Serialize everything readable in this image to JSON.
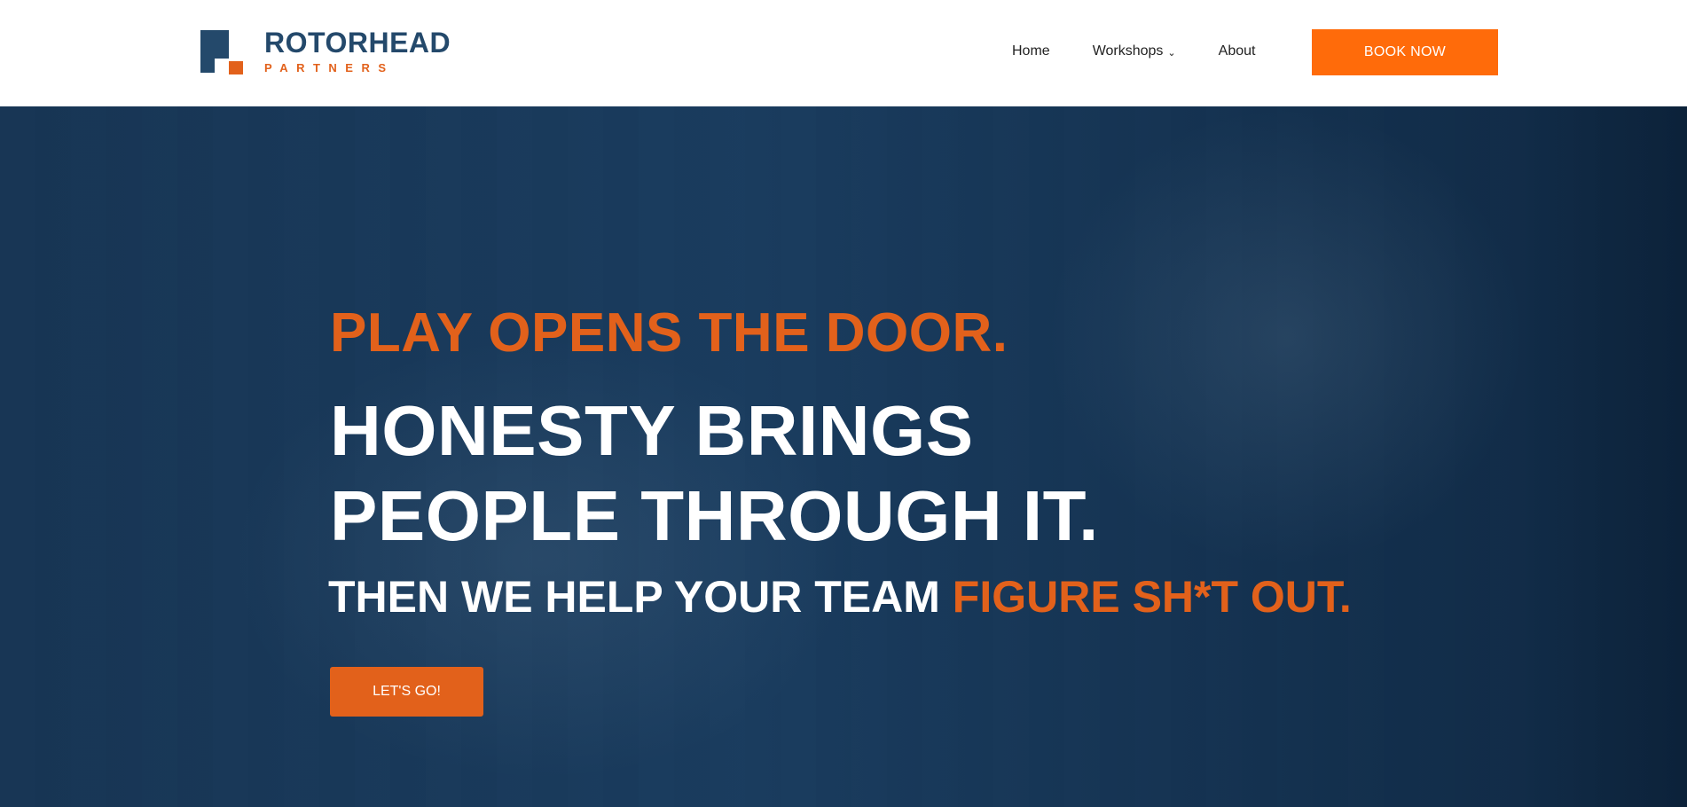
{
  "header": {
    "logo": {
      "title": "ROTORHEAD",
      "subtitle": "PARTNERS",
      "mark_icon": "rotorhead-logo-icon"
    },
    "nav": {
      "home": "Home",
      "workshops": "Workshops",
      "workshops_icon": "chevron-down-icon",
      "about": "About"
    },
    "book_now": "BOOK NOW"
  },
  "hero": {
    "line1": "PLAY OPENS THE DOOR.",
    "line2a": "HONESTY BRINGS",
    "line2b": "PEOPLE THROUGH IT.",
    "line3_white": "THEN WE HELP YOUR TEAM",
    "line3_orange": "FIGURE SH*T OUT.",
    "cta": "LET'S GO!"
  },
  "colors": {
    "brand_navy": "#24496b",
    "brand_orange": "#e2611b",
    "button_orange": "#ff6b0a",
    "hero_overlay": "#1d4468"
  }
}
